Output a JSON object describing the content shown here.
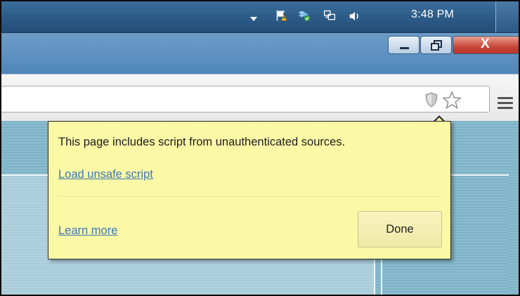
{
  "taskbar": {
    "clock": "3:48 PM",
    "tray_icons": [
      "chevron-down-icon",
      "action-center-flag-icon",
      "network-share-icon",
      "network-icon",
      "volume-icon"
    ]
  },
  "window": {
    "controls": [
      "minimize",
      "maximize",
      "close"
    ],
    "close_label": "X"
  },
  "toolbar": {
    "icons": [
      "shield-icon",
      "star-icon",
      "menu-icon"
    ]
  },
  "bubble": {
    "message": "This page includes script from unauthenticated sources.",
    "load_link": "Load unsafe script",
    "learn_link": "Learn more",
    "done_label": "Done"
  },
  "colors": {
    "bubble_bg": "#fbf8a6",
    "link": "#3d76b5",
    "taskbar": "#2e5d89"
  }
}
